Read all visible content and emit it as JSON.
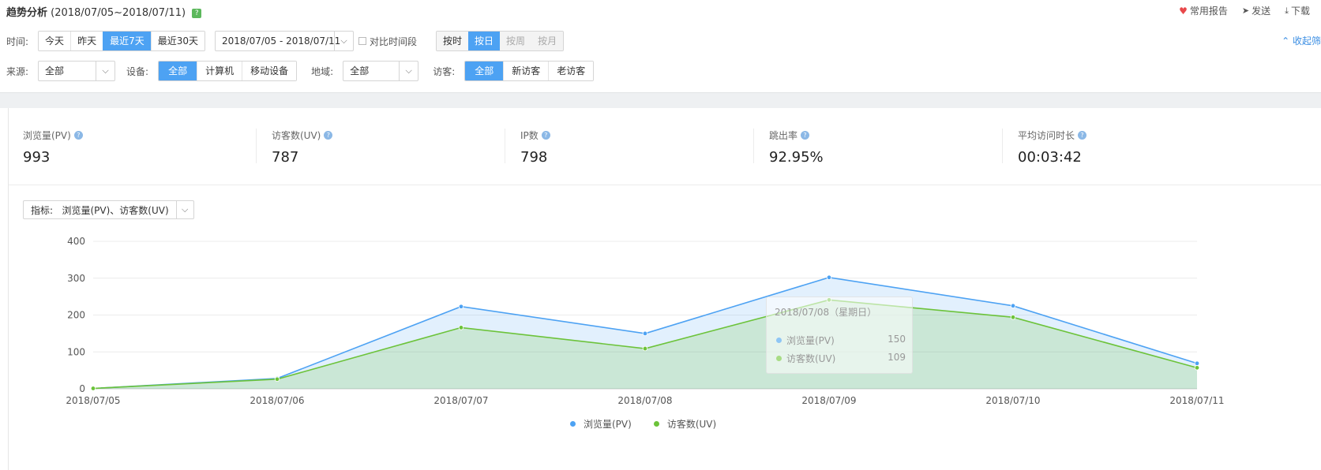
{
  "header": {
    "title": "趋势分析",
    "range": "(2018/07/05~2018/07/11)",
    "help": "?",
    "actions": [
      {
        "label": "常用报告"
      },
      {
        "label": "发送"
      },
      {
        "label": "下载"
      }
    ]
  },
  "filters": {
    "time_label": "时间:",
    "time_buttons": [
      "今天",
      "昨天",
      "最近7天",
      "最近30天"
    ],
    "time_active": "最近7天",
    "date_range": "2018/07/05 - 2018/07/11",
    "compare_label": "对比时间段",
    "granularity": [
      "按时",
      "按日",
      "按周",
      "按月"
    ],
    "granularity_active": "按日",
    "collapse_label": "收起筛",
    "source_label": "来源:",
    "source_value": "全部",
    "device_label": "设备:",
    "device_buttons": [
      "全部",
      "计算机",
      "移动设备"
    ],
    "region_label": "地域:",
    "region_value": "全部",
    "visitor_label": "访客:",
    "visitor_buttons": [
      "全部",
      "新访客",
      "老访客"
    ]
  },
  "stats": [
    {
      "name": "浏览量(PV)",
      "value": "993"
    },
    {
      "name": "访客数(UV)",
      "value": "787"
    },
    {
      "name": "IP数",
      "value": "798"
    },
    {
      "name": "跳出率",
      "value": "92.95%"
    },
    {
      "name": "平均访问时长",
      "value": "00:03:42"
    }
  ],
  "metric_select": {
    "label": "指标:",
    "value": "浏览量(PV)、访客数(UV)"
  },
  "tooltip": {
    "title": "2018/07/08（星期日）",
    "rows": [
      {
        "name": "浏览量(PV)",
        "value": "150"
      },
      {
        "name": "访客数(UV)",
        "value": "109"
      }
    ]
  },
  "colors": {
    "pv": "#4da2f3",
    "uv": "#6cc33a",
    "accent": "#4da2f3"
  },
  "chart_data": {
    "type": "area",
    "categories": [
      "2018/07/05",
      "2018/07/06",
      "2018/07/07",
      "2018/07/08",
      "2018/07/09",
      "2018/07/10",
      "2018/07/11"
    ],
    "series": [
      {
        "name": "浏览量(PV)",
        "values": [
          1,
          28,
          223,
          150,
          302,
          225,
          69
        ]
      },
      {
        "name": "访客数(UV)",
        "values": [
          1,
          26,
          166,
          109,
          241,
          194,
          57
        ]
      }
    ],
    "yticks": [
      0,
      100,
      200,
      300,
      400
    ],
    "ylim": [
      0,
      400
    ],
    "legend": "bottom-center",
    "grid": true
  }
}
